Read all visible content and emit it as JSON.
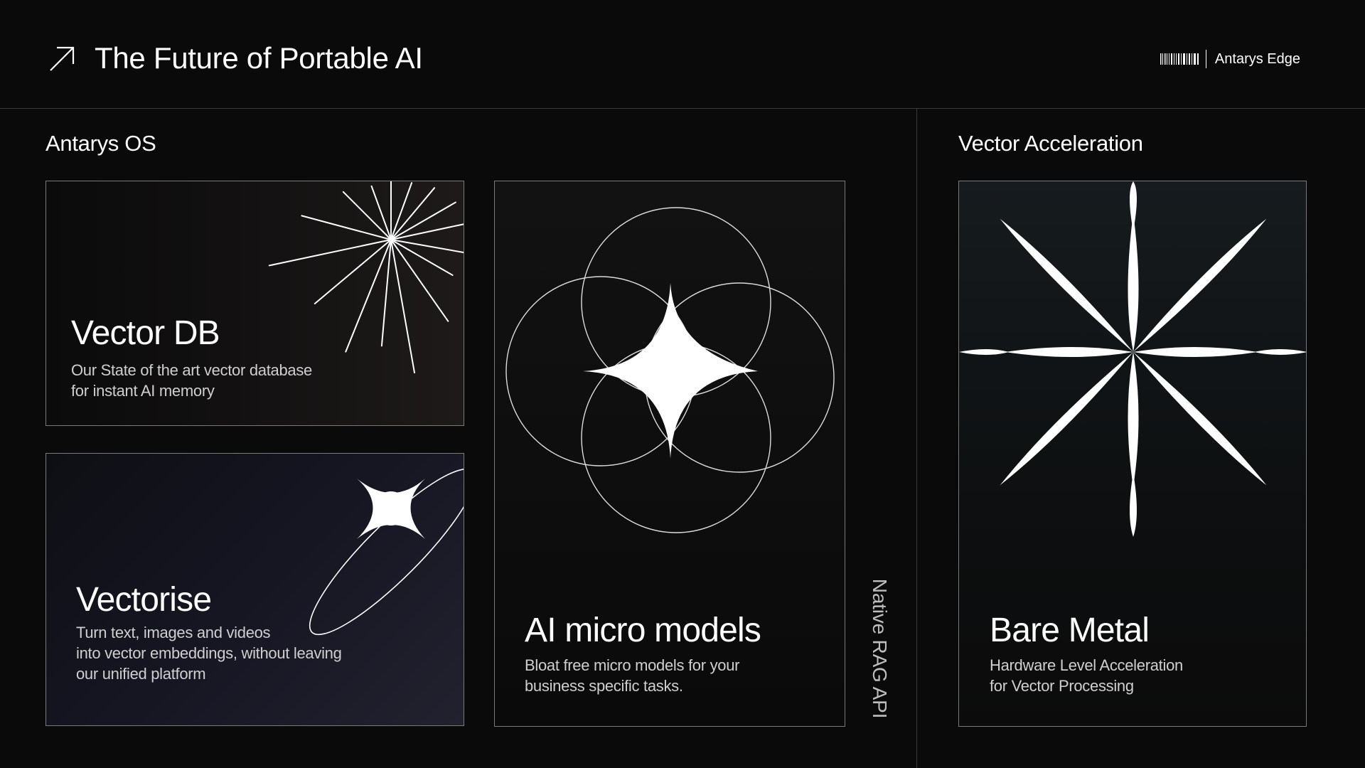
{
  "header": {
    "title": "The Future of Portable AI",
    "brand": "Antarys Edge"
  },
  "sections": {
    "left_title": "Antarys OS",
    "right_title": "Vector Acceleration"
  },
  "cards": [
    {
      "title": "Vector DB",
      "description": "Our State of the art vector database\nfor instant AI memory",
      "icon": "starburst-icon"
    },
    {
      "title": "Vectorise",
      "description": "Turn text, images and videos\ninto vector embeddings, without leaving\nour unified platform",
      "icon": "orbit-star-icon"
    },
    {
      "title": "AI micro models",
      "description": "Bloat free micro models for your\nbusiness specific tasks.",
      "icon": "circles-star-icon"
    },
    {
      "title": "Bare Metal",
      "description": "Hardware Level Acceleration\nfor Vector Processing",
      "icon": "petal-star-icon"
    }
  ],
  "vertical_label": "Native RAG API",
  "colors": {
    "background": "#0a0a0a",
    "foreground": "#ffffff",
    "divider": "#3a3a3a",
    "card_border": "#7a7a7a"
  }
}
